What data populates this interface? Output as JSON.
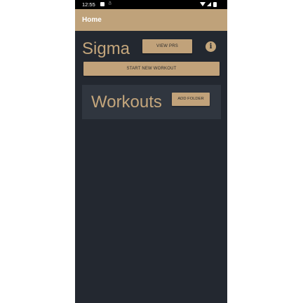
{
  "status_bar": {
    "time": "12:55",
    "icons": [
      "notification-icon",
      "debug-icon",
      "wifi-icon",
      "signal-icon",
      "battery-icon"
    ]
  },
  "app_bar": {
    "title": "Home"
  },
  "profile": {
    "name": "Sigma",
    "view_prs_label": "VIEW PRS",
    "info_icon": "i"
  },
  "start_workout_label": "START NEW WORKOUT",
  "folder_section": {
    "title": "Workouts",
    "add_folder_label": "ADD FOLDER"
  },
  "colors": {
    "accent": "#bfa27a",
    "background": "#232830",
    "card": "#30363f"
  }
}
